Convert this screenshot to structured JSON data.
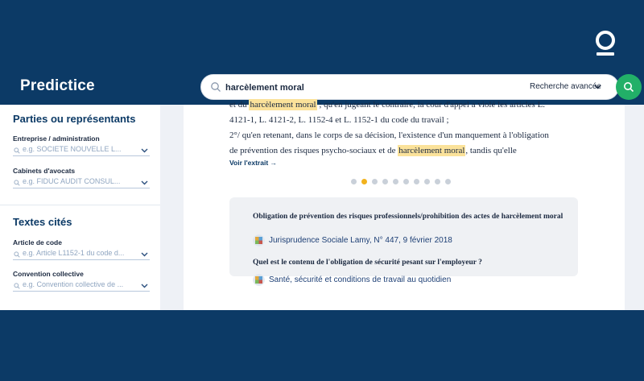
{
  "header": {
    "brand": "Predictice",
    "search": {
      "value": "harcèlement moral",
      "placeholder": ""
    },
    "advanced_search": "Recherche avancée"
  },
  "sidebar": {
    "sections": [
      {
        "title": "Parties ou représentants",
        "fields": [
          {
            "label": "Entreprise / administration",
            "placeholder": "e.g. SOCIETE NOUVELLE L..."
          },
          {
            "label": "Cabinets d'avocats",
            "placeholder": "e.g. FIDUC AUDIT CONSUL..."
          }
        ]
      },
      {
        "title": "Textes cités",
        "fields": [
          {
            "label": "Article de code",
            "placeholder": "e.g. Article L1152-1 du code d..."
          },
          {
            "label": "Convention collective",
            "placeholder": "e.g. Convention collective de ..."
          }
        ]
      }
    ]
  },
  "excerpt": {
    "line0_pre": "et du ",
    "line0_hl": "harcèlement moral",
    "line0_post": " ; qu'en jugeant le contraire, la cour d'appel a violé les articles L.",
    "line1": "4121-1, L. 4121-2, L. 1152-4 et L. 1152-1 du code du travail ;",
    "line2": "2°/ qu'en retenant, dans le corps de sa décision, l'existence d'un manquement à l'obligation",
    "line3_pre": "de prévention des risques psycho-sociaux et de ",
    "line3_hl": "harcèlement moral",
    "line3_post": ", tandis qu'elle",
    "see_more": "Voir l'extrait →"
  },
  "pagination": {
    "total": 10,
    "active": 1,
    "active_color": "#f2b21d",
    "inactive_color": "#c9d0d9"
  },
  "related": [
    {
      "question": "Obligation de prévention des risques professionnels/prohibition des actes de harcèlement moral",
      "source": "Jurisprudence Sociale Lamy, N° 447, 9 février 2018"
    },
    {
      "question": "Quel est le contenu de l'obligation de sécurité pesant sur l'employeur ?",
      "source": "Santé, sécurité et conditions de travail au quotidien"
    }
  ],
  "colors": {
    "brand_navy": "#0c3a66",
    "search_green": "#22b068",
    "highlight": "#fbe29a"
  }
}
